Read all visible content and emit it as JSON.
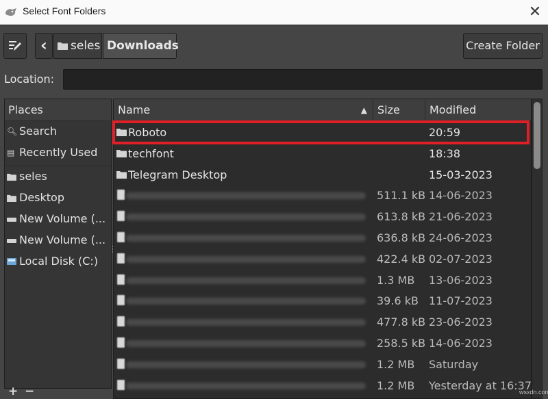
{
  "window": {
    "title": "Select Font Folders",
    "close_glyph": "✕"
  },
  "toolbar": {
    "back_glyph": "‹",
    "breadcrumbs": [
      "seles",
      "Downloads"
    ],
    "create_folder_label": "Create Folder"
  },
  "location": {
    "label": "Location:",
    "value": ""
  },
  "places": {
    "header": "Places",
    "items": [
      {
        "label": "Search",
        "icon": "search-icon"
      },
      {
        "label": "Recently Used",
        "icon": "recent-icon"
      },
      {
        "label": "seles",
        "icon": "folder-icon"
      },
      {
        "label": "Desktop",
        "icon": "folder-icon"
      },
      {
        "label": "New Volume (...",
        "icon": "drive-icon"
      },
      {
        "label": "New Volume (...",
        "icon": "drive-icon"
      },
      {
        "label": "Local Disk (C:)",
        "icon": "disk-icon"
      }
    ],
    "add_glyph": "+",
    "remove_glyph": "−"
  },
  "files": {
    "columns": {
      "name": "Name",
      "size": "Size",
      "modified": "Modified"
    },
    "rows": [
      {
        "name": "Roboto",
        "size": "",
        "modified": "20:59",
        "type": "folder"
      },
      {
        "name": "techfont",
        "size": "",
        "modified": "18:38",
        "type": "folder"
      },
      {
        "name": "Telegram Desktop",
        "size": "",
        "modified": "15-03-2023",
        "type": "folder"
      },
      {
        "name": "",
        "size": "511.1 kB",
        "modified": "14-06-2023",
        "type": "file"
      },
      {
        "name": "",
        "size": "613.8 kB",
        "modified": "21-06-2023",
        "type": "file"
      },
      {
        "name": "",
        "size": "636.8 kB",
        "modified": "24-06-2023",
        "type": "file"
      },
      {
        "name": "",
        "size": "422.4 kB",
        "modified": "02-07-2023",
        "type": "file"
      },
      {
        "name": "",
        "size": "1.3 MB",
        "modified": "13-06-2023",
        "type": "file"
      },
      {
        "name": "",
        "size": "39.6 kB",
        "modified": "11-07-2023",
        "type": "file"
      },
      {
        "name": "",
        "size": "477.8 kB",
        "modified": "23-06-2023",
        "type": "file"
      },
      {
        "name": "",
        "size": "258.5 kB",
        "modified": "14-06-2023",
        "type": "file"
      },
      {
        "name": "",
        "size": "1.2 MB",
        "modified": "Saturday",
        "type": "file"
      },
      {
        "name": "",
        "size": "1.2 MB",
        "modified": "Yesterday at 16:37",
        "type": "file"
      }
    ]
  },
  "colors": {
    "highlight": "#e01f26",
    "background": "#454545"
  },
  "watermark": "wsxdn.com"
}
